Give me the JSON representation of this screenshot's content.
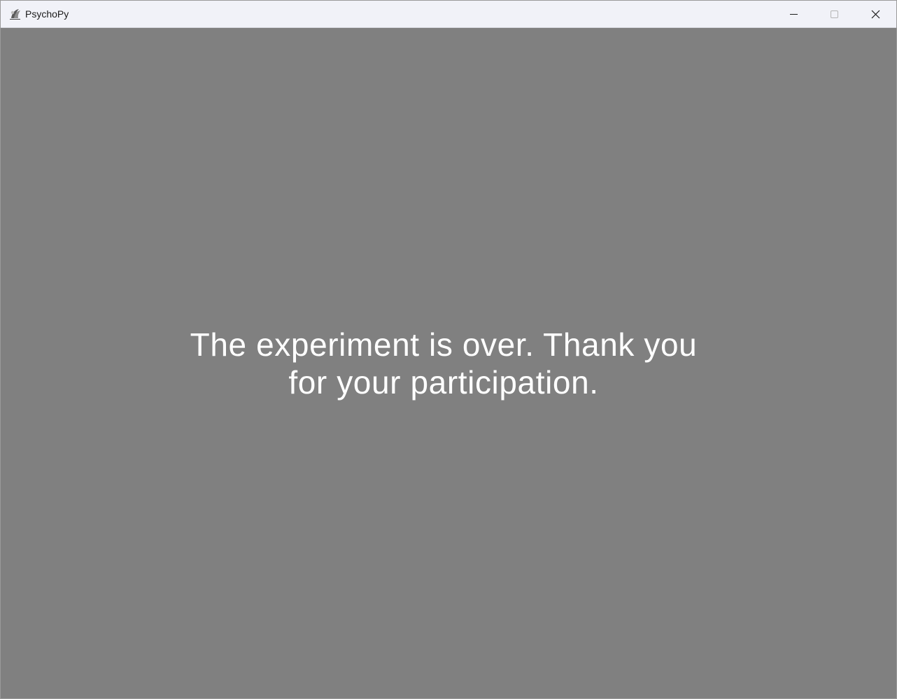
{
  "window": {
    "title": "PsychoPy",
    "icon": "psychopy-logo-icon",
    "controls": {
      "minimize": "minimize-icon",
      "maximize": "maximize-icon",
      "close": "close-icon"
    },
    "background_color": "#808080",
    "titlebar_color": "#f1f2f8"
  },
  "stimulus": {
    "lines": [
      "The experiment is over. Thank you",
      "for your participation."
    ],
    "color": "#ffffff"
  }
}
